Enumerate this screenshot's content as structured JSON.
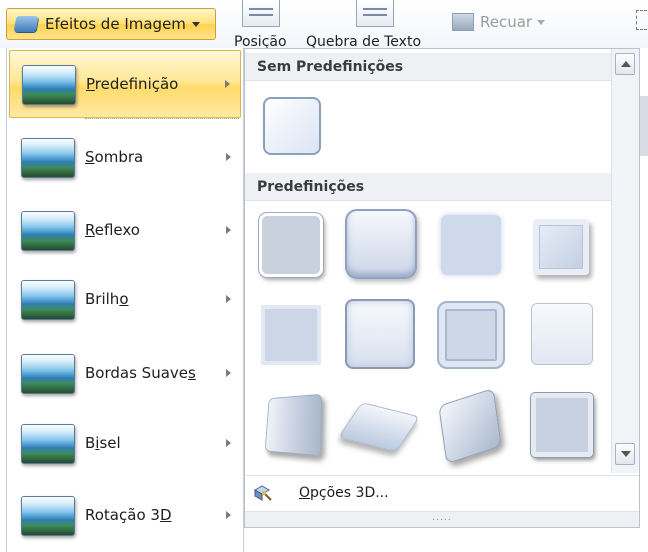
{
  "ribbon": {
    "effects_button_label": "Efeitos de Imagem",
    "position_label": "Posição",
    "wrap_label": "Quebra de Texto",
    "send_back_label": "Recuar"
  },
  "menu": {
    "items": [
      {
        "label_pre": "",
        "hotkey": "P",
        "label_post": "redefinição"
      },
      {
        "label_pre": "",
        "hotkey": "S",
        "label_post": "ombra"
      },
      {
        "label_pre": "",
        "hotkey": "R",
        "label_post": "eflexo"
      },
      {
        "label_pre": "Brilh",
        "hotkey": "o",
        "label_post": ""
      },
      {
        "label_pre": "Bordas Suave",
        "hotkey": "s",
        "label_post": ""
      },
      {
        "label_pre": "B",
        "hotkey": "i",
        "label_post": "sel"
      },
      {
        "label_pre": "Rotação 3",
        "hotkey": "D",
        "label_post": ""
      }
    ]
  },
  "gallery": {
    "section_none": "Sem Predefinições",
    "section_presets": "Predefinições",
    "options_pre": "",
    "options_hotkey": "O",
    "options_post": "pções 3D...",
    "grip": "....."
  }
}
